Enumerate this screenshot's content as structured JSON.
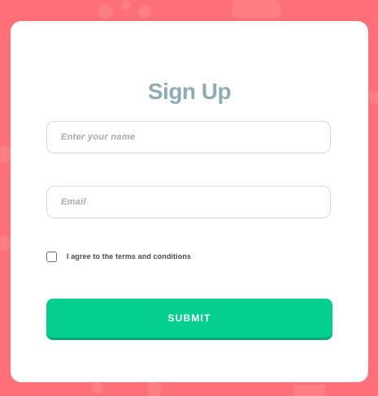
{
  "signup": {
    "title": "Sign Up",
    "name_placeholder": "Enter your name",
    "name_value": "",
    "email_placeholder": "Email",
    "email_value": "",
    "agree_label": "I agree to the terms and conditions",
    "agree_checked": false,
    "submit_label": "SUBMIT"
  },
  "colors": {
    "background": "#ff6f78",
    "card": "#ffffff",
    "title": "#8facb6",
    "submit": "#05cf8e"
  }
}
